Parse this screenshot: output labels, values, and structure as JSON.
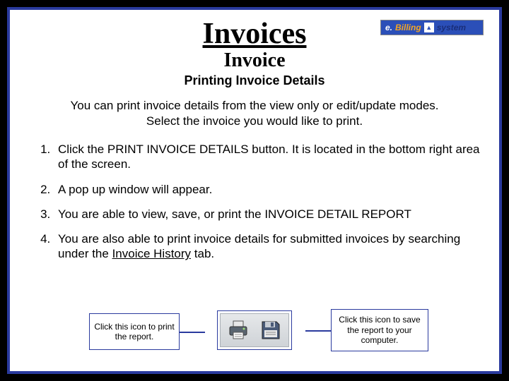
{
  "logo": {
    "e": "e.",
    "billing": "Billing",
    "system": "system"
  },
  "title": "Invoices",
  "subtitle": "Invoice",
  "section_title": "Printing Invoice Details",
  "intro": {
    "line1": "You can print invoice details from the view only or edit/update modes.",
    "line2": "Select the invoice you would like to print."
  },
  "steps": {
    "s1": "Click the PRINT INVOICE DETAILS button. It is located in the bottom right area of the screen.",
    "s2": "A pop up window will appear.",
    "s3": "You are able to view, save, or print the INVOICE DETAIL REPORT",
    "s4_pre": "You are also able to print invoice details for submitted invoices by searching under the ",
    "s4_link": "Invoice History",
    "s4_post": " tab."
  },
  "callouts": {
    "left": "Click this icon to print the report.",
    "right": "Click this icon to save the report to your computer."
  }
}
